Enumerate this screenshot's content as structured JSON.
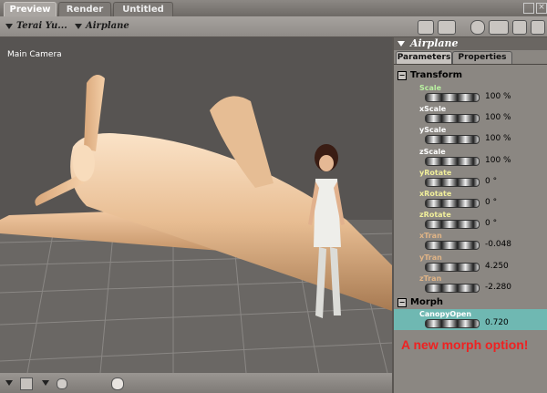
{
  "tabs": {
    "preview": "Preview",
    "render": "Render",
    "untitled": "Untitled"
  },
  "toolbar": {
    "figure_select": "Terai Yu...",
    "actor_select": "Airplane"
  },
  "viewport": {
    "camera_label": "Main Camera"
  },
  "panel": {
    "title": "Airplane",
    "tabs": {
      "parameters": "Parameters",
      "properties": "Properties"
    },
    "transform_header": "Transform",
    "morph_header": "Morph",
    "params": [
      {
        "label": "Scale",
        "value": "100 %",
        "color": "#b8f0a0"
      },
      {
        "label": "xScale",
        "value": "100 %",
        "color": "#ffffff"
      },
      {
        "label": "yScale",
        "value": "100 %",
        "color": "#ffffff"
      },
      {
        "label": "zScale",
        "value": "100 %",
        "color": "#ffffff"
      },
      {
        "label": "yRotate",
        "value": "0 °",
        "color": "#f0ee9a"
      },
      {
        "label": "xRotate",
        "value": "0 °",
        "color": "#f0ee9a"
      },
      {
        "label": "zRotate",
        "value": "0 °",
        "color": "#f0ee9a"
      },
      {
        "label": "xTran",
        "value": "-0.048",
        "color": "#e0b486"
      },
      {
        "label": "yTran",
        "value": "4.250",
        "color": "#e0b486"
      },
      {
        "label": "zTran",
        "value": "-2.280",
        "color": "#e0b486"
      }
    ],
    "morph_param": {
      "label": "CanopyOpen",
      "value": "0.720",
      "color": "#ffffff"
    }
  },
  "annotation": "A new morph option!",
  "colors": {
    "morph_highlight": "#6fb8b2",
    "annotation": "#ee2222"
  }
}
